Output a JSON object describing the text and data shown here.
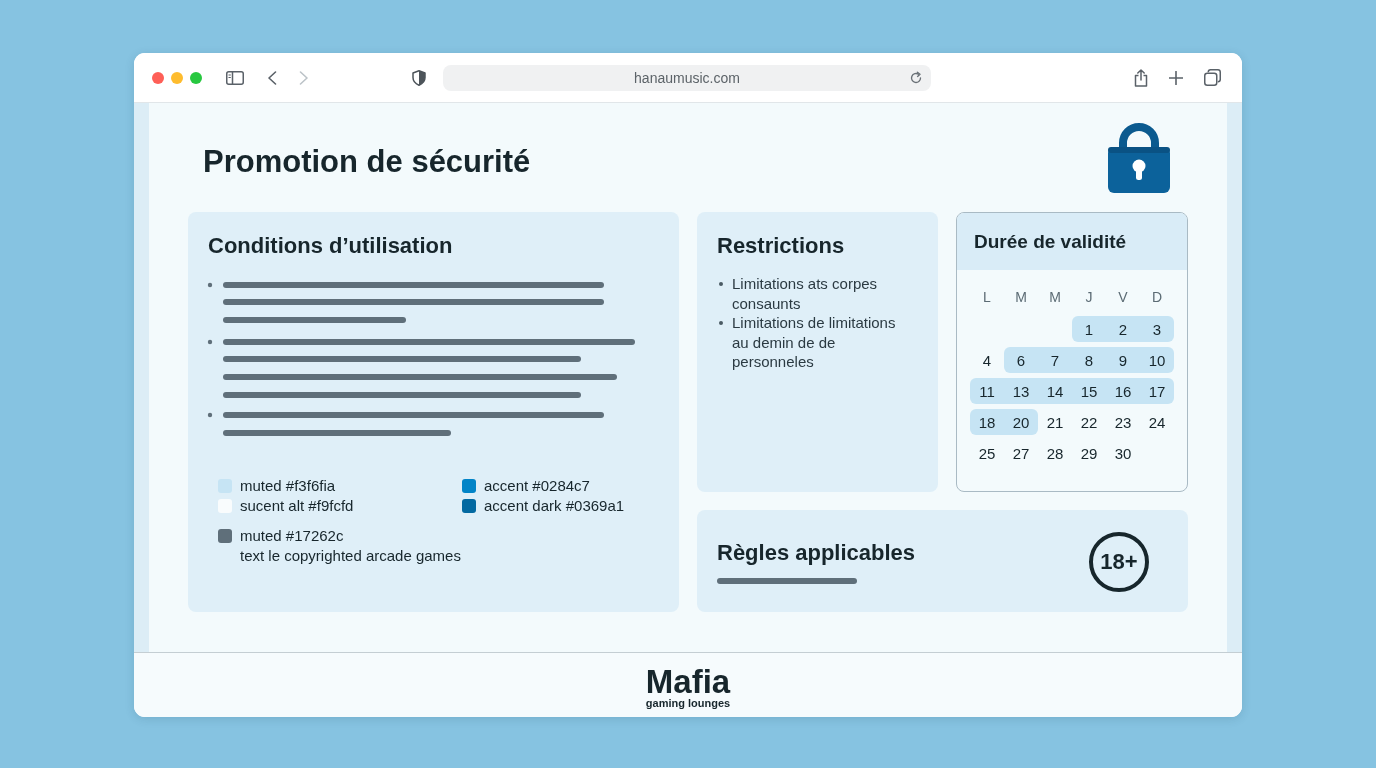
{
  "browser": {
    "nav_buttons": [
      {
        "kind": "back",
        "disabled": false
      },
      {
        "kind": "forward",
        "disabled": true
      }
    ],
    "url": "hanaumusic.com"
  },
  "page": {
    "title": "Promotion de sécurité",
    "conditions": {
      "title": "Conditions d’utilisation",
      "legend": [
        {
          "label": "muted #f3f6fia",
          "color": "#c6e4f4"
        },
        {
          "label": "accent #0284c7",
          "color": "#0284c7"
        },
        {
          "label": "sucent alt #f9fcfd",
          "color": "#f9fcfd"
        },
        {
          "label": "accent dark #0369a1",
          "color": "#0369a1"
        },
        {
          "label": "muted #17262c",
          "color": "#5f6f7a",
          "note": "text le copyrighted arcade games"
        }
      ]
    },
    "restrictions": {
      "title": "Restrictions",
      "items": [
        "Limitations ats corpes consaunts",
        "Limitations de limitations au demin de de personneles"
      ]
    },
    "calendar": {
      "title": "Durée de validité",
      "weekdays": [
        "L",
        "M",
        "M",
        "J",
        "V",
        "D"
      ],
      "weeks": [
        {
          "days": [
            {
              "kind": "empty"
            },
            {
              "kind": "empty"
            },
            {
              "kind": "empty"
            },
            {
              "kind": "day",
              "label": "1",
              "highlighted": true
            },
            {
              "kind": "day",
              "label": "2",
              "highlighted": true
            },
            {
              "kind": "day",
              "label": "3",
              "highlighted": true
            }
          ]
        },
        {
          "days": [
            {
              "kind": "day",
              "label": "4",
              "highlighted": false
            },
            {
              "kind": "day",
              "label": "6",
              "highlighted": true
            },
            {
              "kind": "day",
              "label": "7",
              "highlighted": true
            },
            {
              "kind": "day",
              "label": "8",
              "highlighted": true
            },
            {
              "kind": "day",
              "label": "9",
              "highlighted": true
            },
            {
              "kind": "day",
              "label": "10",
              "highlighted": true
            }
          ]
        },
        {
          "days": [
            {
              "kind": "day",
              "label": "11",
              "highlighted": true
            },
            {
              "kind": "day",
              "label": "13",
              "highlighted": true
            },
            {
              "kind": "day",
              "label": "14",
              "highlighted": true
            },
            {
              "kind": "day",
              "label": "15",
              "highlighted": true
            },
            {
              "kind": "day",
              "label": "16",
              "highlighted": true
            },
            {
              "kind": "day",
              "label": "17",
              "highlighted": true
            }
          ]
        },
        {
          "days": [
            {
              "kind": "day",
              "label": "18",
              "highlighted": true
            },
            {
              "kind": "day",
              "label": "20",
              "highlighted": true
            },
            {
              "kind": "day",
              "label": "21",
              "highlighted": false
            },
            {
              "kind": "day",
              "label": "22",
              "highlighted": false
            },
            {
              "kind": "day",
              "label": "23",
              "highlighted": false
            },
            {
              "kind": "day",
              "label": "24",
              "highlighted": false
            }
          ]
        },
        {
          "days": [
            {
              "kind": "day",
              "label": "25",
              "highlighted": false
            },
            {
              "kind": "day",
              "label": "27",
              "highlighted": false
            },
            {
              "kind": "day",
              "label": "28",
              "highlighted": false
            },
            {
              "kind": "day",
              "label": "29",
              "highlighted": false
            },
            {
              "kind": "day",
              "label": "30",
              "highlighted": false
            }
          ]
        }
      ]
    },
    "rules": {
      "title": "Règles applicables",
      "badge": "18+"
    }
  },
  "footer": {
    "brand": "Mafia",
    "tagline": "gaming lounges"
  }
}
